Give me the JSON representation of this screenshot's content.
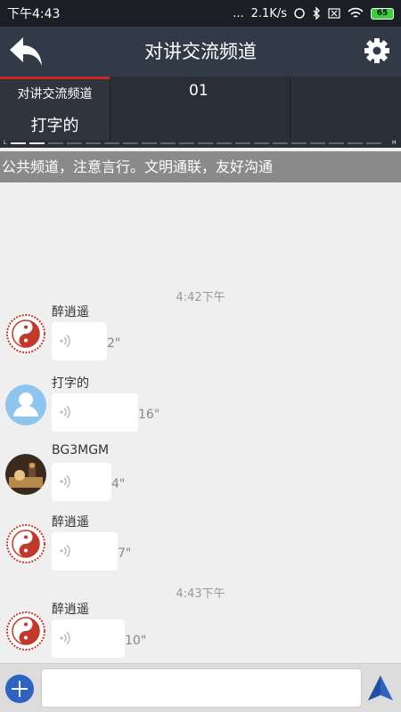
{
  "status_bar": {
    "time": "下午4:43",
    "dots": "...",
    "speed": "2.1K/s",
    "battery": "65"
  },
  "header": {
    "title": "对讲交流频道",
    "back_icon": "back-arrow-icon",
    "settings_icon": "gear-icon"
  },
  "tabs": [
    {
      "label": "对讲交流频道",
      "sub": "打字的"
    },
    {
      "label": "01"
    },
    {
      "label": ""
    }
  ],
  "level_indicator": {
    "low": "L",
    "high": "H"
  },
  "notice": "公共频道，注意言行。文明通联，友好沟通",
  "messages": [
    {
      "time_header": "4:42下午"
    },
    {
      "user": "醉逍遥",
      "duration": "2\""
    },
    {
      "user": "打字的",
      "duration": "16\""
    },
    {
      "user": "BG3MGM",
      "duration": "4\""
    },
    {
      "user": "醉逍遥",
      "duration": "7\""
    },
    {
      "time_header": "4:43下午"
    },
    {
      "user": "醉逍遥",
      "duration": "10\""
    }
  ],
  "input": {
    "placeholder": "",
    "value": ""
  },
  "colors": {
    "header_bg": "#323a48",
    "tab_bg": "#2a2e36",
    "active_tab_accent": "#c62828",
    "notice_bg": "#8a8a8a",
    "plus_button": "#2e63c4"
  }
}
